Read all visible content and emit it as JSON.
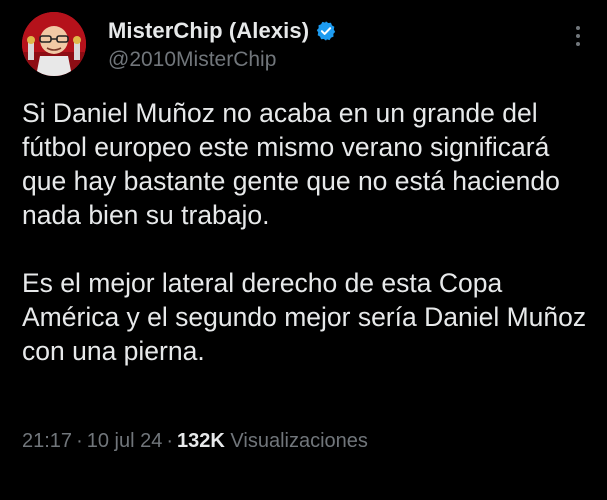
{
  "author": {
    "display_name": "MisterChip (Alexis)",
    "handle": "@2010MisterChip",
    "verified": true
  },
  "tweet": {
    "paragraphs": [
      "Si Daniel Muñoz no acaba en un grande del fútbol europeo este mismo verano significará que hay bastante gente que no está haciendo nada bien su trabajo.",
      "Es el mejor lateral derecho de esta Copa América y el segundo mejor sería Daniel Muñoz con una pierna."
    ]
  },
  "meta": {
    "time": "21:17",
    "date": "10 jul 24",
    "views_count": "132K",
    "views_label": "Visualizaciones",
    "separator": "·"
  },
  "icons": {
    "verified": "verified-badge-icon",
    "more": "more-options-icon"
  },
  "colors": {
    "background": "#000000",
    "text_primary": "#e7e9ea",
    "text_secondary": "#71767b",
    "verified_blue": "#1d9bf0"
  }
}
